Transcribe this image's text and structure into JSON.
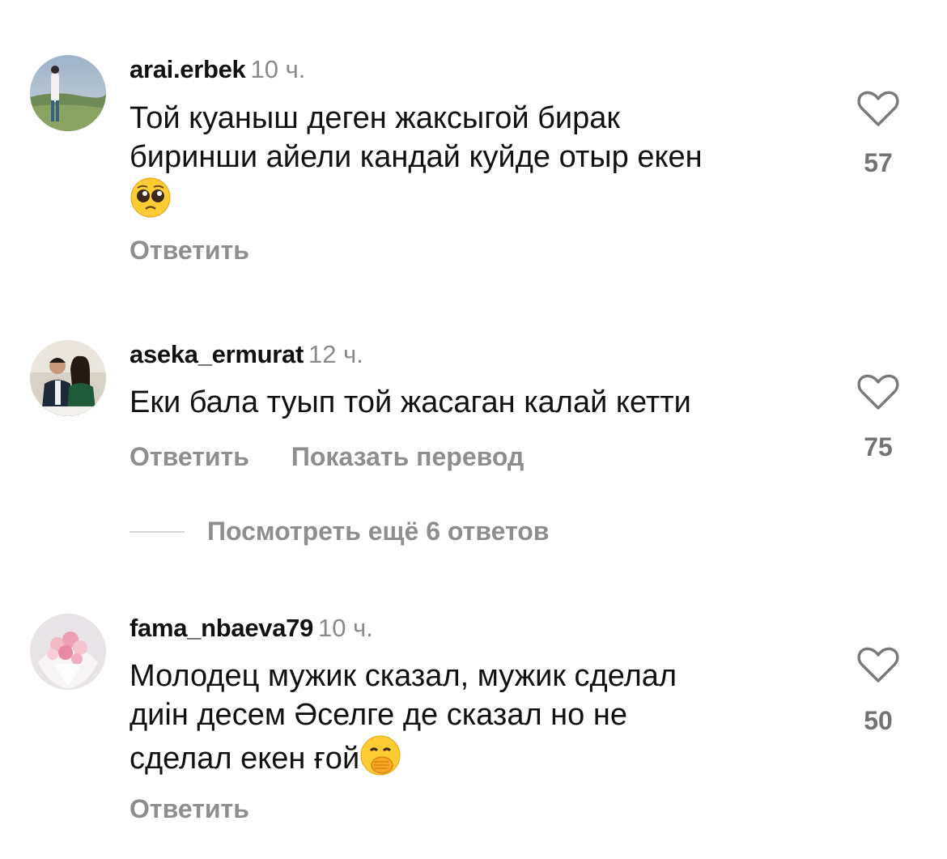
{
  "comments": [
    {
      "username": "arai.erbek",
      "time": "10 ч.",
      "text_lines": [
        "Той куаныш деген жаксыгой бирак",
        "биринши айели кандай куйде отыр екен"
      ],
      "emoji": "pleading-face",
      "likes": "57",
      "actions": [
        "Ответить"
      ]
    },
    {
      "username": "aseka_ermurat",
      "time": "12 ч.",
      "text_lines": [
        "Еки бала туып той жасаган калай кетти"
      ],
      "likes": "75",
      "actions": [
        "Ответить",
        "Показать перевод"
      ],
      "view_replies": "Посмотреть ещё 6 ответов"
    },
    {
      "username": "fama_nbaeva79",
      "time": "10 ч.",
      "text_lines": [
        "Молодец мужик сказал, мужик сделал",
        "диін десем Әселге де сказал но не",
        "сделал екен ғой"
      ],
      "emoji": "face-with-hand-over-mouth",
      "likes": "50",
      "actions": [
        "Ответить"
      ]
    }
  ],
  "colors": {
    "text": "#111111",
    "secondary": "#8e8e8e",
    "divider": "#d6d6d6"
  }
}
